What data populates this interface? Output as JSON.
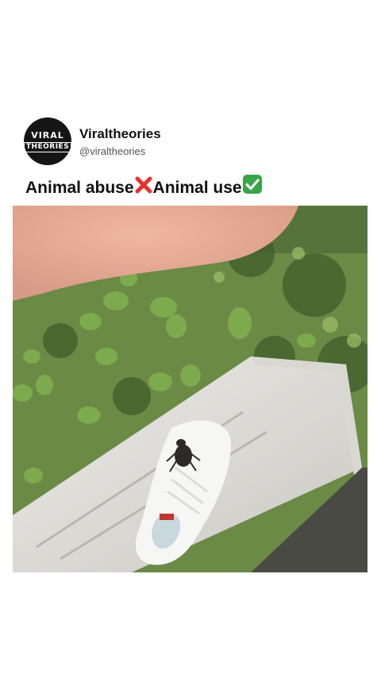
{
  "post": {
    "author": {
      "display_name": "Viraltheories",
      "handle": "@viraltheories",
      "avatar_logo": {
        "top": "VIRAL",
        "bottom": "THEORIES"
      }
    },
    "caption": {
      "part1": "Animal abuse",
      "part2": "Animal use",
      "icon1": "cross-mark-icon",
      "icon2": "check-mark-icon"
    }
  },
  "colors": {
    "cross": "#e5322d",
    "check": "#3aa44a",
    "avatar_bg": "#151515"
  }
}
